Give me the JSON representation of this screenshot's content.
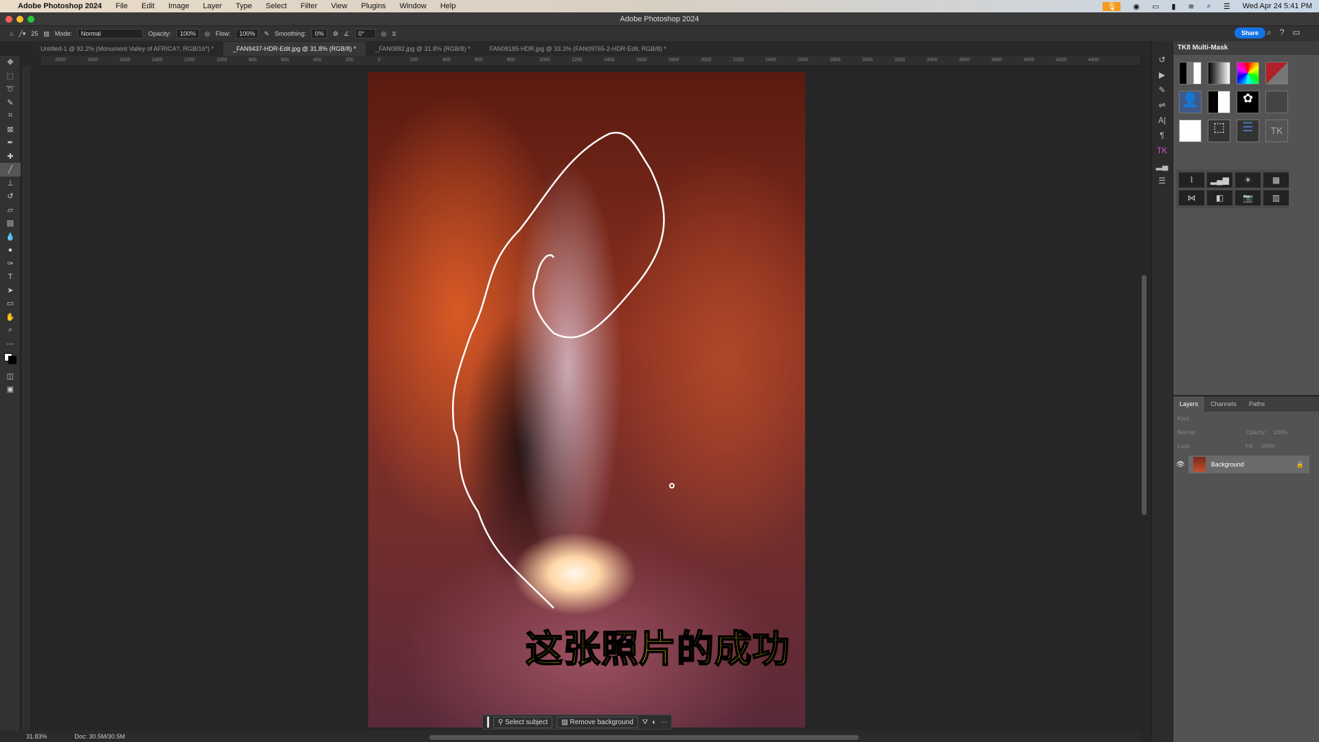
{
  "menubar": {
    "app": "Adobe Photoshop 2024",
    "items": [
      "File",
      "Edit",
      "Image",
      "Layer",
      "Type",
      "Select",
      "Filter",
      "View",
      "Plugins",
      "Window",
      "Help"
    ],
    "datetime": "Wed Apr 24  5:41 PM"
  },
  "window": {
    "title": "Adobe Photoshop 2024"
  },
  "options": {
    "brush_size": "25",
    "mode_label": "Mode:",
    "mode": "Normal",
    "opacity_label": "Opacity:",
    "opacity": "100%",
    "flow_label": "Flow:",
    "flow": "100%",
    "smoothing_label": "Smoothing:",
    "smoothing": "0%",
    "angle": "0°",
    "share": "Share"
  },
  "tabs": [
    {
      "label": "Untitled-1 @ 92.2% (Monument Valley of AFRICA?, RGB/16*) *"
    },
    {
      "label": "_FAN9437-HDR-Edit.jpg @ 31.8% (RGB/8) *",
      "active": true
    },
    {
      "label": "_FAN0882.jpg @ 31.8% (RGB/8) *"
    },
    {
      "label": "FAN08185-HDR.jpg @ 33.3% (FAN09765-2-HDR-Edit, RGB/8) *"
    }
  ],
  "ruler": [
    "2000",
    "1800",
    "1600",
    "1400",
    "1200",
    "1000",
    "800",
    "600",
    "400",
    "200",
    "0",
    "200",
    "400",
    "600",
    "800",
    "1000",
    "1200",
    "1400",
    "1600",
    "1800",
    "2000",
    "2200",
    "2400",
    "2600",
    "2800",
    "3000",
    "3200",
    "3400",
    "3600",
    "3800",
    "4000",
    "4200",
    "4400"
  ],
  "subtitle": "这张照片的成功",
  "contextbar": {
    "select_subject": "Select subject",
    "remove_background": "Remove background"
  },
  "status": {
    "zoom": "31.83%",
    "doc": "Doc: 30.5M/30.5M"
  },
  "tk_panel": {
    "title": "TK8 Multi-Mask"
  },
  "layers": {
    "tabs": [
      "Layers",
      "Channels",
      "Paths"
    ],
    "kind": "Kind",
    "blend": "Normal",
    "opacity_label": "Opacity:",
    "opacity": "100%",
    "lock_label": "Lock:",
    "fill_label": "Fill:",
    "fill": "100%",
    "items": [
      {
        "name": "Background",
        "locked": true,
        "visible": true
      }
    ]
  }
}
